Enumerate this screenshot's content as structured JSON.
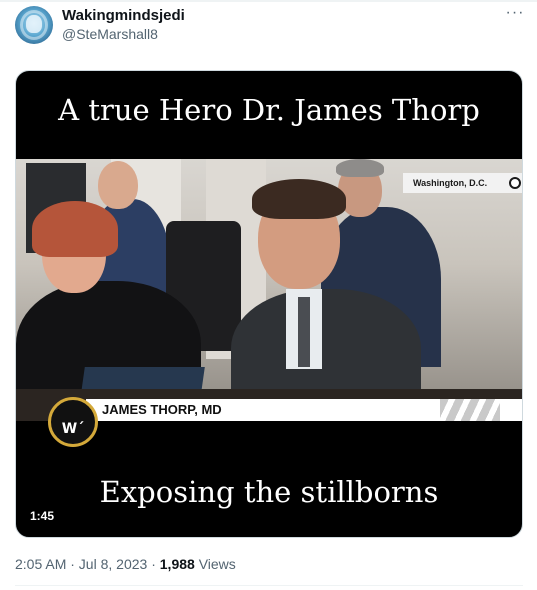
{
  "tweet": {
    "display_name": "Wakingmindsjedi",
    "handle": "@SteMarshall8",
    "more_label": "···",
    "timestamp": "2:05 AM · Jul 8, 2023",
    "separator": " · ",
    "views_count": "1,988",
    "views_label": " Views"
  },
  "video": {
    "caption_top": "A true Hero Dr. James Thorp",
    "caption_bottom": "Exposing the stillborns",
    "location_tag": "Washington, D.C.",
    "name_banner": "JAMES THORP, MD",
    "logo_text": "W´",
    "duration": "1:45"
  }
}
